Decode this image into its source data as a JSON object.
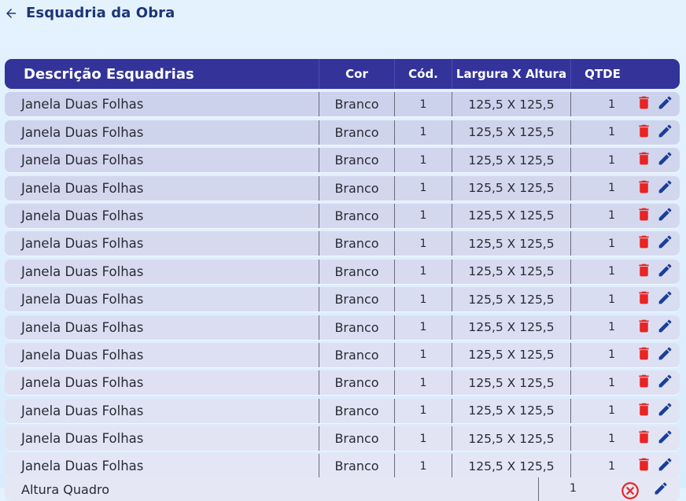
{
  "header": {
    "title": "Esquadria da Obra",
    "back_icon": "arrow-left-icon"
  },
  "table": {
    "columns": [
      "Descrição Esquadrias",
      "Cor",
      "Cód.",
      "Largura X Altura",
      "QTDE"
    ],
    "rows": [
      {
        "descricao": "Janela Duas Folhas",
        "cor": "Branco",
        "cod": "1",
        "dimensao": "125,5 X 125,5",
        "qtde": "1"
      },
      {
        "descricao": "Janela Duas Folhas",
        "cor": "Branco",
        "cod": "1",
        "dimensao": "125,5 X 125,5",
        "qtde": "1"
      },
      {
        "descricao": "Janela Duas Folhas",
        "cor": "Branco",
        "cod": "1",
        "dimensao": "125,5 X 125,5",
        "qtde": "1"
      },
      {
        "descricao": "Janela Duas Folhas",
        "cor": "Branco",
        "cod": "1",
        "dimensao": "125,5 X 125,5",
        "qtde": "1"
      },
      {
        "descricao": "Janela Duas Folhas",
        "cor": "Branco",
        "cod": "1",
        "dimensao": "125,5 X 125,5",
        "qtde": "1"
      },
      {
        "descricao": "Janela Duas Folhas",
        "cor": "Branco",
        "cod": "1",
        "dimensao": "125,5 X 125,5",
        "qtde": "1"
      },
      {
        "descricao": "Janela Duas Folhas",
        "cor": "Branco",
        "cod": "1",
        "dimensao": "125,5 X 125,5",
        "qtde": "1"
      },
      {
        "descricao": "Janela Duas Folhas",
        "cor": "Branco",
        "cod": "1",
        "dimensao": "125,5 X 125,5",
        "qtde": "1"
      },
      {
        "descricao": "Janela Duas Folhas",
        "cor": "Branco",
        "cod": "1",
        "dimensao": "125,5 X 125,5",
        "qtde": "1"
      },
      {
        "descricao": "Janela Duas Folhas",
        "cor": "Branco",
        "cod": "1",
        "dimensao": "125,5 X 125,5",
        "qtde": "1"
      },
      {
        "descricao": "Janela Duas Folhas",
        "cor": "Branco",
        "cod": "1",
        "dimensao": "125,5 X 125,5",
        "qtde": "1"
      },
      {
        "descricao": "Janela Duas Folhas",
        "cor": "Branco",
        "cod": "1",
        "dimensao": "125,5 X 125,5",
        "qtde": "1"
      },
      {
        "descricao": "Janela Duas Folhas",
        "cor": "Branco",
        "cod": "1",
        "dimensao": "125,5 X 125,5",
        "qtde": "1"
      },
      {
        "descricao": "Janela Duas Folhas",
        "cor": "Branco",
        "cod": "1",
        "dimensao": "125,5 X 125,5",
        "qtde": "1"
      }
    ],
    "partial_row": {
      "descricao": "Altura Quadro",
      "qtde": "1"
    },
    "row_actions": [
      "delete-icon",
      "edit-icon"
    ]
  },
  "colors": {
    "header_bg": "#33339a",
    "title": "#1d3578",
    "delete": "#e82424",
    "edit": "#1a3f9a"
  }
}
